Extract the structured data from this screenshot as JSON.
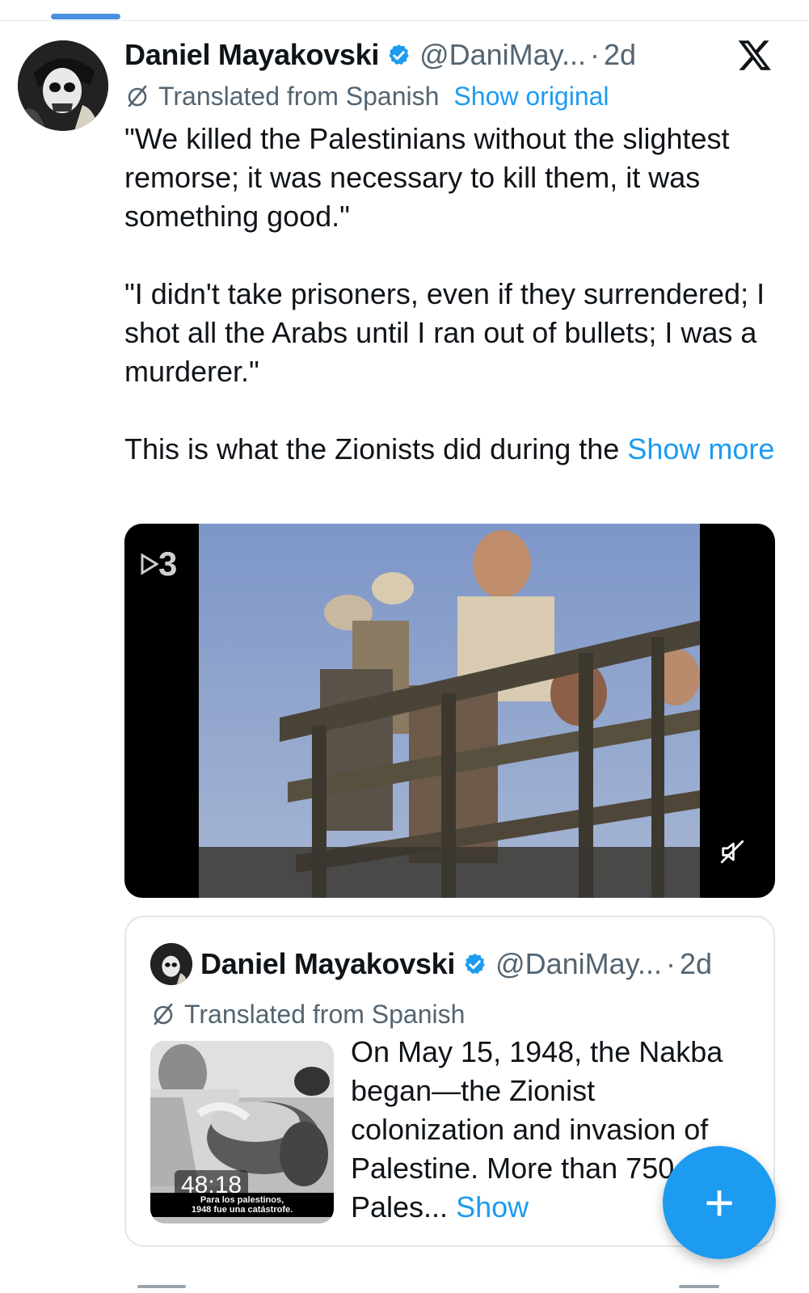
{
  "tweet": {
    "author": {
      "display_name": "Daniel Mayakovski",
      "handle": "@DaniMay...",
      "separator": "·",
      "time": "2d",
      "verified": true
    },
    "translation": {
      "label": "Translated from Spanish",
      "show_original": "Show original"
    },
    "body": {
      "paragraph1": "\"We killed the Palestinians without the slightest remorse; it was necessary to kill them, it was something good.\"",
      "paragraph2": "\"I didn't take prisoners, even if they surrendered; I shot all the Arabs until I ran out of bullets; I was a murderer.\"",
      "paragraph3": "This is what the Zionists did during the ",
      "show_more": "Show more"
    },
    "video": {
      "channel_logo_text": "3",
      "muted": true
    }
  },
  "quoted_tweet": {
    "author": {
      "display_name": "Daniel Mayakovski",
      "handle": "@DaniMay...",
      "separator": "·",
      "time": "2d",
      "verified": true
    },
    "translation_label": "Translated from Spanish",
    "thumbnail": {
      "duration": "48:18",
      "caption_line1": "Para los palestinos,",
      "caption_line2": "1948 fue una catástrofe."
    },
    "text": "On May 15, 1948, the Nakba began—the Zionist colonization and invasion of Palestine. More than 750,000 Pales... ",
    "show_more": "Show"
  },
  "fab": {
    "label": "+"
  },
  "icons": {
    "verified": "verified-badge-icon",
    "x_logo": "x-logo-icon",
    "translate": "translate-icon",
    "mute": "mute-icon"
  },
  "colors": {
    "accent": "#1d9bf0",
    "secondary_text": "#536471",
    "primary_text": "#0f1419"
  }
}
